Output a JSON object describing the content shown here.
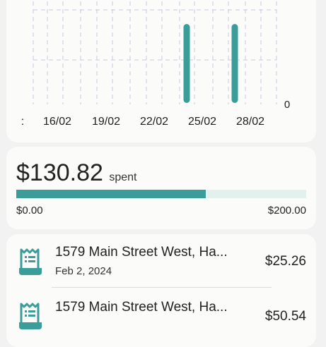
{
  "chart_data": {
    "type": "bar",
    "x_tick_labels": [
      ":",
      "16/02",
      "19/02",
      "22/02",
      "25/02",
      "28/02"
    ],
    "y_tick_label": "0",
    "bars": [
      {
        "date": "25/02"
      },
      {
        "date": "28/02"
      }
    ],
    "grid": true,
    "bar_color": "#3b9d99"
  },
  "budget": {
    "spent_amount": "$130.82",
    "spent_label": "spent",
    "progress_fraction": 0.654,
    "min_label": "$0.00",
    "max_label": "$200.00",
    "fill_color": "#3b9d99",
    "track_color": "#e3f1ee"
  },
  "transactions": [
    {
      "title": "1579 Main Street West, Ha...",
      "date": "Feb 2, 2024",
      "amount": "$25.26",
      "icon": "receipt-icon"
    },
    {
      "title": "1579 Main Street West, Ha...",
      "date": "",
      "amount": "$50.54",
      "icon": "receipt-icon"
    }
  ],
  "accent_color": "#3b9d99"
}
